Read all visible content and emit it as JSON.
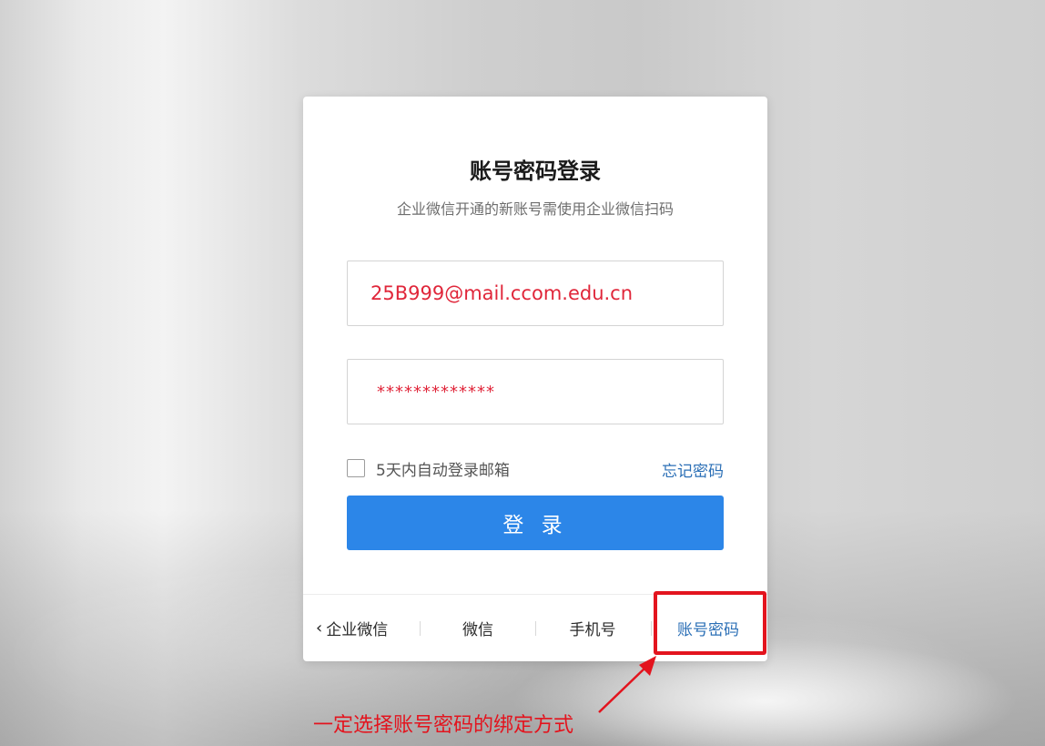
{
  "login": {
    "title": "账号密码登录",
    "subtitle": "企业微信开通的新账号需使用企业微信扫码",
    "account_value": "25B999@mail.ccom.edu.cn",
    "password_mask": "*************",
    "remember_label": "5天内自动登录邮箱",
    "forgot_label": "忘记密码",
    "submit_label": "登 录"
  },
  "login_tabs": {
    "back_label": "企业微信",
    "wechat_label": "微信",
    "phone_label": "手机号",
    "account_label": "账号密码"
  },
  "annotation": {
    "text": "一定选择账号密码的绑定方式"
  },
  "colors": {
    "accent": "#2c86e8",
    "link": "#2b6fb6",
    "annotation_red": "#e3141e",
    "input_text_red": "#e0263a"
  }
}
